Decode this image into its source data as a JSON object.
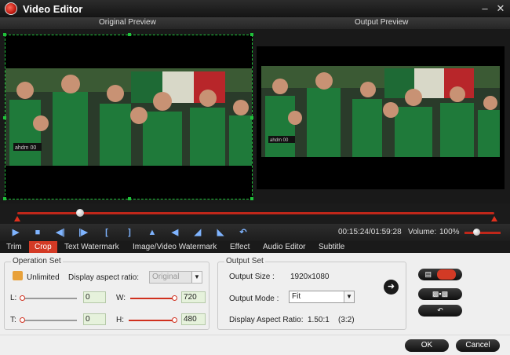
{
  "window": {
    "title": "Video Editor",
    "minimize_icon": "minimize-icon",
    "close_icon": "close-icon"
  },
  "preview": {
    "original_label": "Original Preview",
    "output_label": "Output Preview"
  },
  "controls": {
    "time": "00:15:24/01:59:28",
    "volume_label": "Volume:",
    "volume_value": "100%",
    "buttons": [
      "play-icon",
      "stop-icon",
      "previous-frame-icon",
      "next-frame-icon",
      "mark-in-icon",
      "mark-out-icon",
      "flip-vertical-icon",
      "flip-horizontal-icon",
      "rotate-left-icon",
      "rotate-right-icon",
      "undo-icon"
    ]
  },
  "tabs": [
    {
      "label": "Trim"
    },
    {
      "label": "Crop"
    },
    {
      "label": "Text Watermark"
    },
    {
      "label": "Image/Video Watermark"
    },
    {
      "label": "Effect"
    },
    {
      "label": "Audio Editor"
    },
    {
      "label": "Subtitle"
    }
  ],
  "operation_set": {
    "title": "Operation Set",
    "unlimited_label": "Unlimited",
    "aspect_label": "Display aspect ratio:",
    "aspect_value": "Original",
    "left_label": "L:",
    "left_value": "0",
    "width_label": "W:",
    "width_value": "720",
    "top_label": "T:",
    "top_value": "0",
    "height_label": "H:",
    "height_value": "480"
  },
  "output_set": {
    "title": "Output Set",
    "size_label": "Output Size :",
    "size_value": "1920x1080",
    "mode_label": "Output Mode :",
    "mode_value": "Fit",
    "ratio_label": "Display Aspect Ratio:",
    "ratio_value": "1.50:1",
    "ratio_extra": "(3:2)"
  },
  "footer": {
    "ok_label": "OK",
    "cancel_label": "Cancel"
  },
  "colors": {
    "accent": "#d33a25",
    "crop_border": "#1fc33a"
  }
}
